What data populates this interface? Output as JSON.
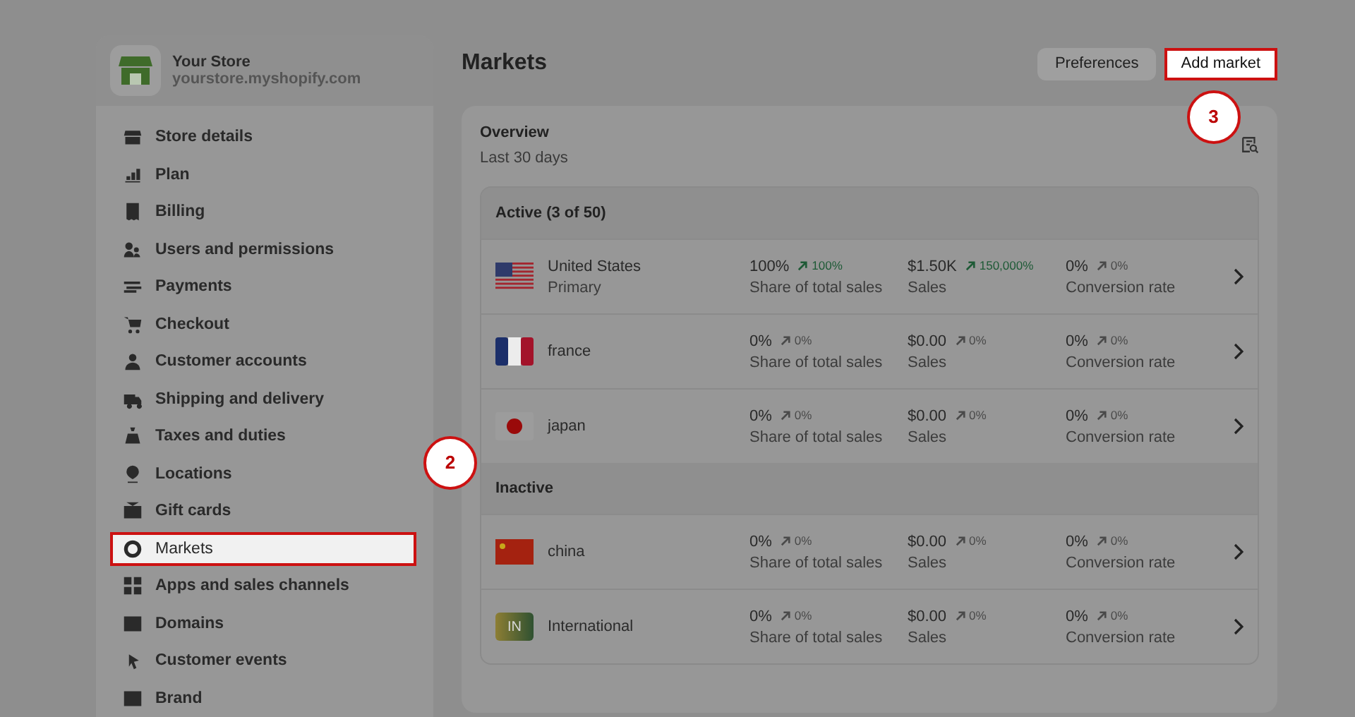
{
  "store": {
    "name": "Your Store",
    "domain": "yourstore.myshopify.com"
  },
  "sidebar": {
    "items": [
      {
        "label": "Store details",
        "highlighted": false
      },
      {
        "label": "Plan",
        "highlighted": false
      },
      {
        "label": "Billing",
        "highlighted": false
      },
      {
        "label": "Users and permissions",
        "highlighted": false
      },
      {
        "label": "Payments",
        "highlighted": false
      },
      {
        "label": "Checkout",
        "highlighted": false
      },
      {
        "label": "Customer accounts",
        "highlighted": false
      },
      {
        "label": "Shipping and delivery",
        "highlighted": false
      },
      {
        "label": "Taxes and duties",
        "highlighted": false
      },
      {
        "label": "Locations",
        "highlighted": false
      },
      {
        "label": "Gift cards",
        "highlighted": false
      },
      {
        "label": "Markets",
        "highlighted": true,
        "callout": "2"
      },
      {
        "label": "Apps and sales channels",
        "highlighted": false
      },
      {
        "label": "Domains",
        "highlighted": false
      },
      {
        "label": "Customer events",
        "highlighted": false
      },
      {
        "label": "Brand",
        "highlighted": false
      }
    ]
  },
  "page": {
    "title": "Markets",
    "buttons": [
      {
        "label": "Preferences",
        "kind": "secondary",
        "highlighted": false
      },
      {
        "label": "Add market",
        "kind": "primary",
        "highlighted": true,
        "callout": "3"
      }
    ]
  },
  "overview": {
    "title": "Overview",
    "period": "Last 30 days",
    "groups": [
      {
        "title": "Active (3 of 50)",
        "rows": [
          {
            "kind": "us",
            "name": "United States",
            "subtitle": "Primary",
            "metrics": [
              {
                "value": "100%",
                "change": "100%",
                "kind": "up",
                "label": "Share of total sales"
              },
              {
                "value": "$1.50K",
                "change": "150,000%",
                "kind": "up",
                "label": "Sales"
              },
              {
                "value": "0%",
                "change": "0%",
                "kind": "flat",
                "label": "Conversion rate"
              }
            ]
          },
          {
            "kind": "fr",
            "name": "france",
            "metrics": [
              {
                "value": "0%",
                "change": "0%",
                "kind": "flat",
                "label": "Share of total sales"
              },
              {
                "value": "$0.00",
                "change": "0%",
                "kind": "flat",
                "label": "Sales"
              },
              {
                "value": "0%",
                "change": "0%",
                "kind": "flat",
                "label": "Conversion rate"
              }
            ]
          },
          {
            "kind": "jp",
            "name": "japan",
            "metrics": [
              {
                "value": "0%",
                "change": "0%",
                "kind": "flat",
                "label": "Share of total sales"
              },
              {
                "value": "$0.00",
                "change": "0%",
                "kind": "flat",
                "label": "Sales"
              },
              {
                "value": "0%",
                "change": "0%",
                "kind": "flat",
                "label": "Conversion rate"
              }
            ]
          }
        ]
      },
      {
        "title": "Inactive",
        "rows": [
          {
            "kind": "cn",
            "name": "china",
            "metrics": [
              {
                "value": "0%",
                "change": "0%",
                "kind": "flat",
                "label": "Share of total sales"
              },
              {
                "value": "$0.00",
                "change": "0%",
                "kind": "flat",
                "label": "Sales"
              },
              {
                "value": "0%",
                "change": "0%",
                "kind": "flat",
                "label": "Conversion rate"
              }
            ]
          },
          {
            "kind": "code",
            "flag_label": "IN",
            "name": "International",
            "metrics": [
              {
                "value": "0%",
                "change": "0%",
                "kind": "flat",
                "label": "Share of total sales"
              },
              {
                "value": "$0.00",
                "change": "0%",
                "kind": "flat",
                "label": "Sales"
              },
              {
                "value": "0%",
                "change": "0%",
                "kind": "flat",
                "label": "Conversion rate"
              }
            ]
          }
        ]
      }
    ]
  }
}
